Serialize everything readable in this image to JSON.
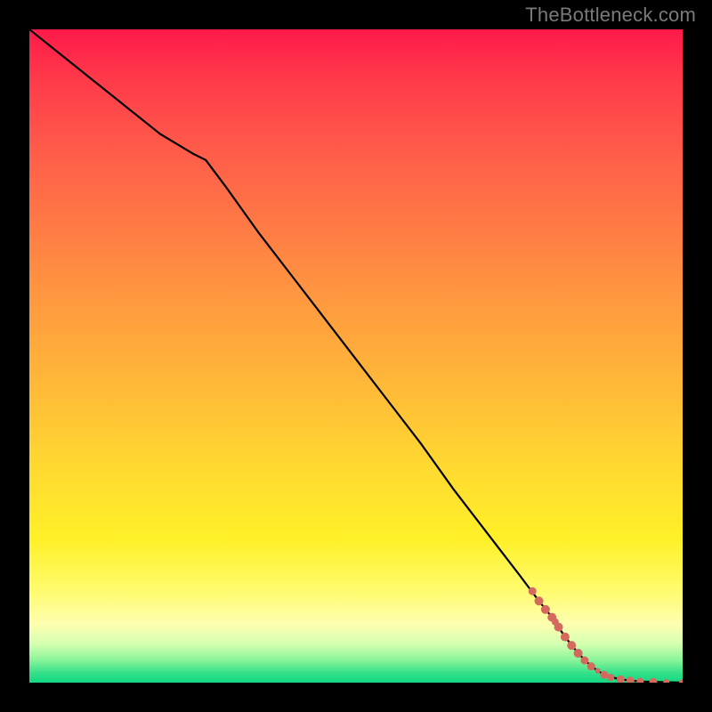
{
  "watermark": "TheBottleneck.com",
  "colors": {
    "page_bg": "#000000",
    "watermark_text": "#7a7a7a",
    "curve_stroke": "#000000",
    "marker_fill": "#d46a5e",
    "gradient_stops": [
      "#ff1a4a",
      "#ff3b4a",
      "#ff5a4a",
      "#ff7a45",
      "#ff9a3f",
      "#ffba38",
      "#ffd930",
      "#fff028",
      "#fffb6e",
      "#feffb0",
      "#d6ffb0",
      "#8cf59a",
      "#35e08a",
      "#12d882"
    ]
  },
  "chart_data": {
    "type": "line",
    "title": "",
    "xlabel": "",
    "ylabel": "",
    "xlim": [
      0,
      100
    ],
    "ylim": [
      0,
      100
    ],
    "curve": {
      "name": "bottleneck-curve",
      "x": [
        0,
        5,
        10,
        15,
        20,
        25,
        27,
        30,
        35,
        40,
        45,
        50,
        55,
        60,
        65,
        70,
        75,
        78,
        80,
        82,
        84,
        86,
        88,
        90,
        92,
        94,
        96,
        98,
        100
      ],
      "y": [
        100,
        96,
        92,
        88,
        84,
        81,
        80,
        76,
        69,
        62.5,
        56,
        49.5,
        43,
        36.5,
        29.5,
        23,
        16.5,
        12.5,
        10,
        7,
        4.5,
        2.5,
        1.2,
        0.6,
        0.3,
        0.15,
        0.1,
        0.05,
        0
      ]
    },
    "markers": {
      "name": "highlight-points",
      "points": [
        {
          "x": 77,
          "y": 14.0,
          "r": 4.5
        },
        {
          "x": 78,
          "y": 12.5,
          "r": 5.0
        },
        {
          "x": 79,
          "y": 11.2,
          "r": 5.0
        },
        {
          "x": 80,
          "y": 10.0,
          "r": 5.0
        },
        {
          "x": 80.5,
          "y": 9.3,
          "r": 4.0
        },
        {
          "x": 81,
          "y": 8.5,
          "r": 5.0
        },
        {
          "x": 82,
          "y": 7.0,
          "r": 5.0
        },
        {
          "x": 83,
          "y": 5.7,
          "r": 5.0
        },
        {
          "x": 84,
          "y": 4.5,
          "r": 5.0
        },
        {
          "x": 85,
          "y": 3.4,
          "r": 4.5
        },
        {
          "x": 86,
          "y": 2.5,
          "r": 4.5
        },
        {
          "x": 87,
          "y": 1.8,
          "r": 3.0
        },
        {
          "x": 88,
          "y": 1.2,
          "r": 4.5
        },
        {
          "x": 89,
          "y": 0.8,
          "r": 4.0
        },
        {
          "x": 90.5,
          "y": 0.5,
          "r": 4.5
        },
        {
          "x": 92,
          "y": 0.3,
          "r": 4.5
        },
        {
          "x": 93.5,
          "y": 0.2,
          "r": 4.0
        },
        {
          "x": 95.5,
          "y": 0.1,
          "r": 4.5
        },
        {
          "x": 97.5,
          "y": 0.05,
          "r": 3.5
        },
        {
          "x": 100,
          "y": 0.0,
          "r": 4.0
        }
      ]
    }
  }
}
